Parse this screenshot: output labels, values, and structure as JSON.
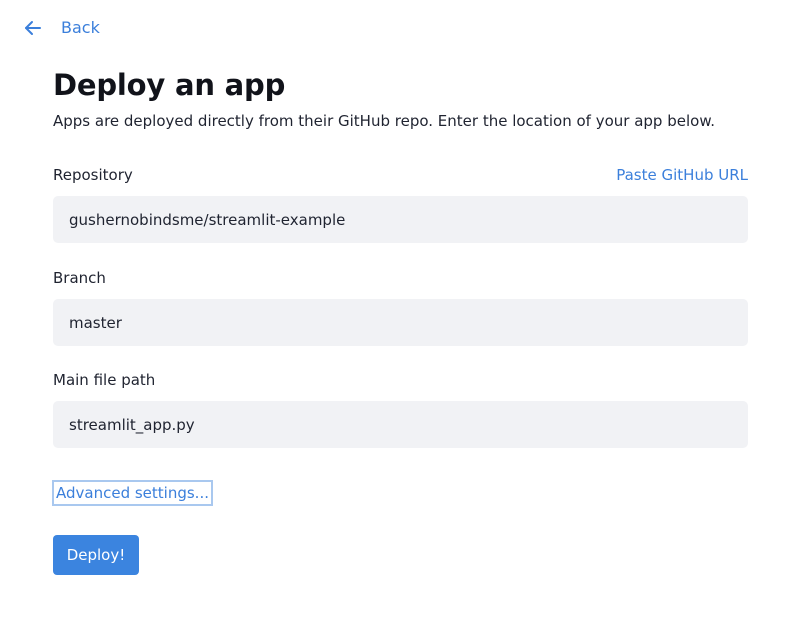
{
  "nav": {
    "back_label": "Back",
    "back_icon": "arrow-left-icon"
  },
  "header": {
    "title": "Deploy an app",
    "subtitle": "Apps are deployed directly from their GitHub repo. Enter the location of your app below."
  },
  "form": {
    "repository": {
      "label": "Repository",
      "value": "gushernobindsme/streamlit-example",
      "paste_link": "Paste GitHub URL"
    },
    "branch": {
      "label": "Branch",
      "value": "master"
    },
    "main_file": {
      "label": "Main file path",
      "value": "streamlit_app.py"
    },
    "advanced_settings": "Advanced settings...",
    "deploy_button": "Deploy!"
  },
  "colors": {
    "accent": "#3b7fdb",
    "button": "#3b84df",
    "input_bg": "#f1f2f5",
    "focus_ring": "#a9c8ef"
  }
}
